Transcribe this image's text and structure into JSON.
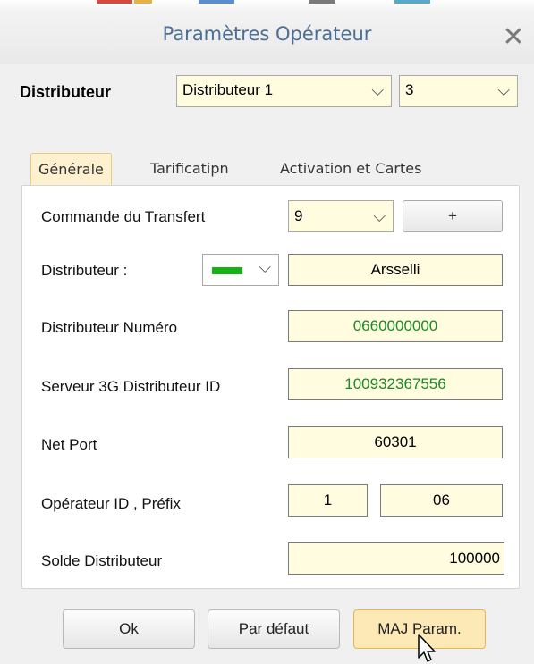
{
  "window": {
    "title": "Paramètres Opérateur",
    "close_glyph": "✕"
  },
  "distributeur": {
    "label": "Distributeur",
    "combo_value": "Distributeur 1",
    "number_value": "3",
    "chevron": "⌵"
  },
  "tabs": [
    {
      "label": "Générale",
      "active": true
    },
    {
      "label": "Tarificatipn",
      "active": false
    },
    {
      "label": "Activation et Cartes",
      "active": false
    }
  ],
  "form": {
    "commande_label": "Commande du Transfert",
    "commande_value": "9",
    "plus_label": "+",
    "distributeur_label": "Distributeur :",
    "distributeur_color": "#14b214",
    "distributeur_name": "Arsselli",
    "numero_label": "Distributeur Numéro",
    "numero_value": "0660000000",
    "serveur_label": "Serveur 3G Distributeur ID",
    "serveur_value": "100932367556",
    "netport_label": "Net Port",
    "netport_value": "60301",
    "operateur_label": "Opérateur ID ,  Préfix",
    "operateur_id": "1",
    "prefix_value": "06",
    "solde_label": "Solde Distributeur",
    "solde_value": "100000"
  },
  "buttons": {
    "ok_label": "Ok",
    "ok_mnemonic": "O",
    "default_label": "Par défaut",
    "default_mnemonic": "d",
    "maj_label": "MAJ Param."
  },
  "colors": {
    "accent_title": "#4a6e96",
    "field_bg": "#fffce0",
    "green_value": "#1c8a25",
    "active_tab": "#fdf1cf",
    "active_button": "#fde9b5"
  },
  "icons": {
    "close": "close-icon",
    "dropdown": "chevron-down-icon",
    "cursor": "mouse-pointer-icon"
  }
}
